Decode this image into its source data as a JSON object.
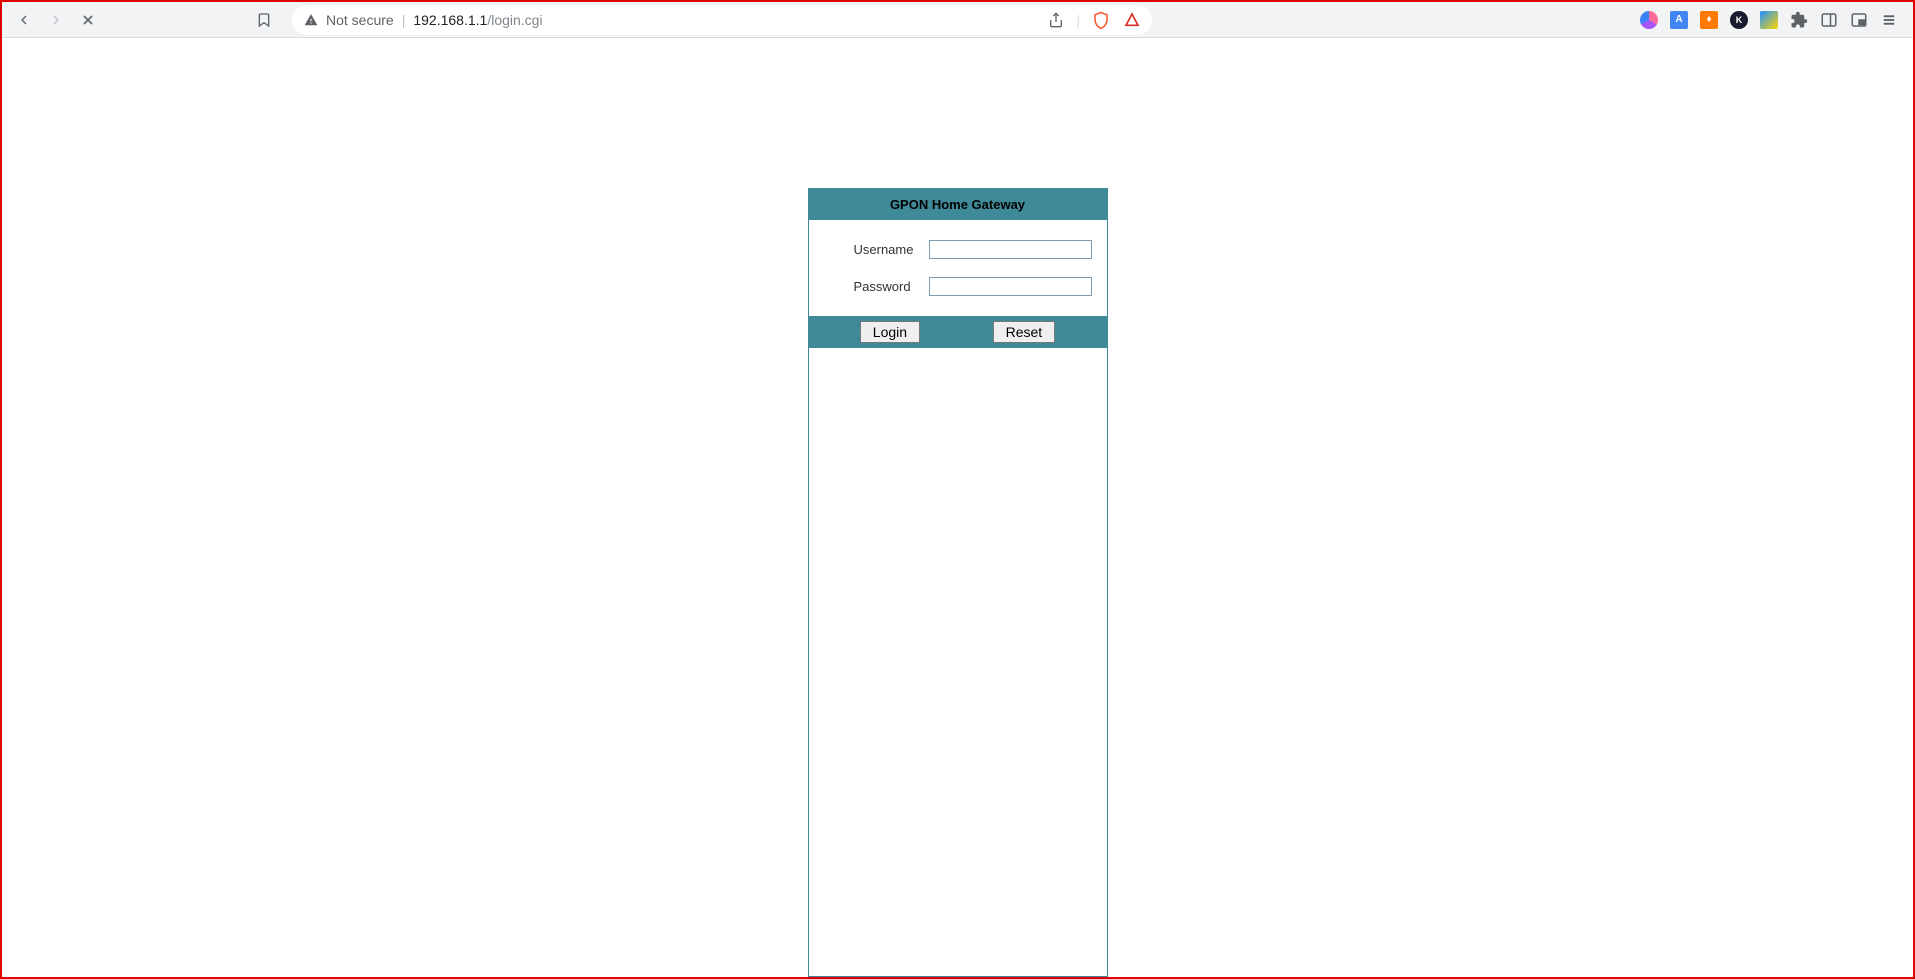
{
  "browser": {
    "security_label": "Not secure",
    "url_host": "192.168.1.1",
    "url_path": "/login.cgi"
  },
  "login": {
    "title": "GPON Home Gateway",
    "username_label": "Username",
    "password_label": "Password",
    "username_value": "",
    "password_value": "",
    "login_button": "Login",
    "reset_button": "Reset"
  }
}
